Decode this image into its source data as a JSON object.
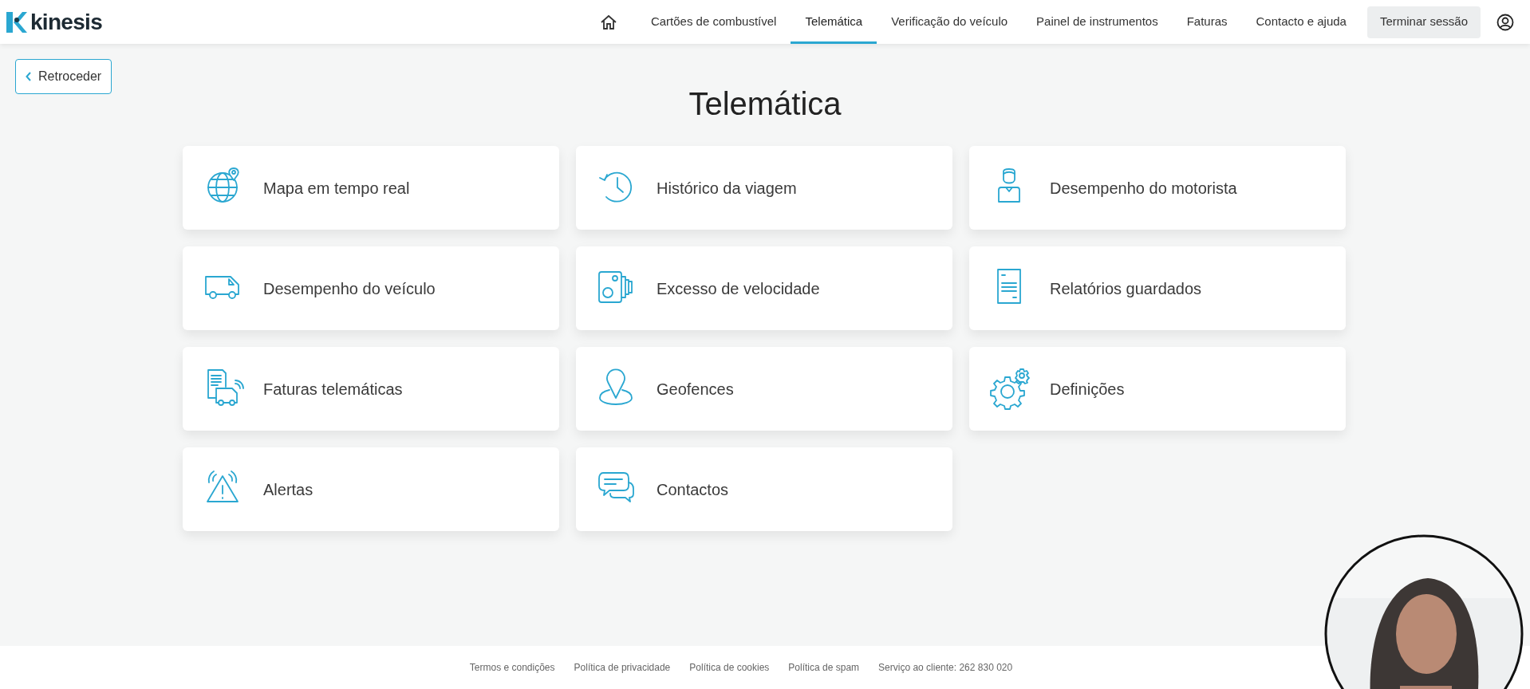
{
  "header": {
    "logo": "kinesis",
    "nav": [
      {
        "label": "Cartões de combustível",
        "selected": false
      },
      {
        "label": "Telemática",
        "selected": true
      },
      {
        "label": "Verificação do veículo",
        "selected": false
      },
      {
        "label": "Painel de instrumentos",
        "selected": false
      },
      {
        "label": "Faturas",
        "selected": false
      },
      {
        "label": "Contacto e ajuda",
        "selected": false
      }
    ],
    "logout": "Terminar sessão"
  },
  "back_button": "Retroceder",
  "title": "Telemática",
  "tiles": [
    {
      "label": "Mapa em tempo real"
    },
    {
      "label": "Histórico da viagem"
    },
    {
      "label": "Desempenho do motorista"
    },
    {
      "label": "Desempenho do veículo"
    },
    {
      "label": "Excesso de velocidade"
    },
    {
      "label": "Relatórios guardados"
    },
    {
      "label": "Faturas telemáticas"
    },
    {
      "label": "Geofences"
    },
    {
      "label": "Definições"
    },
    {
      "label": "Alertas"
    },
    {
      "label": "Contactos"
    }
  ],
  "footer": {
    "links": [
      "Termos e condições",
      "Política de privacidade",
      "Política de cookies",
      "Política de spam",
      "Serviço ao cliente: 262 830 020"
    ]
  }
}
